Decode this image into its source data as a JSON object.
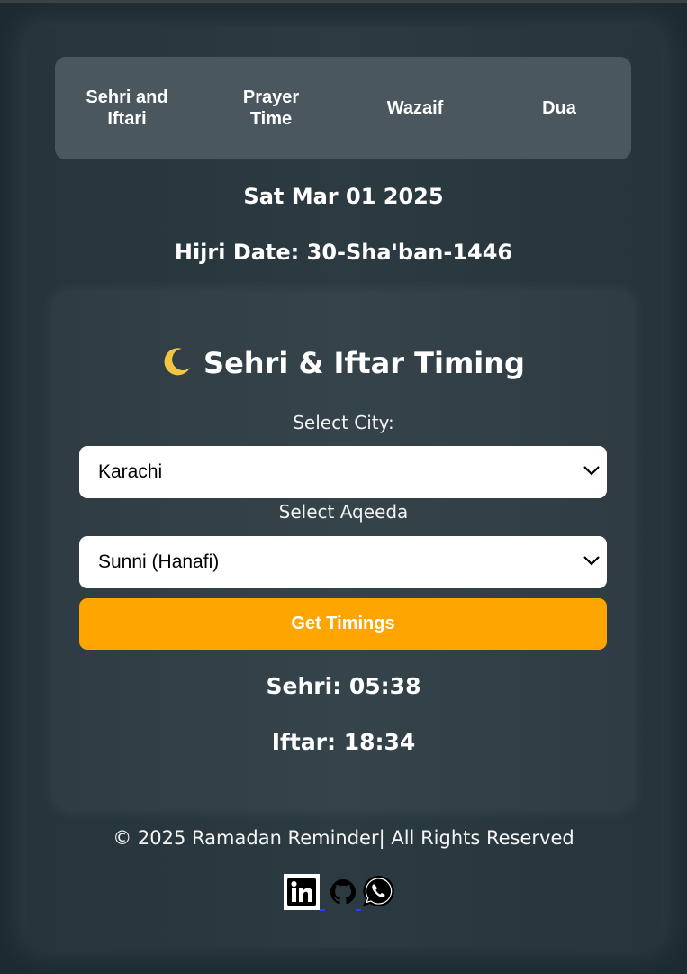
{
  "nav": {
    "items": [
      {
        "label": "Sehri and Iftari"
      },
      {
        "label": "Prayer Time"
      },
      {
        "label": "Wazaif"
      },
      {
        "label": "Dua"
      }
    ]
  },
  "header": {
    "date": "Sat Mar 01 2025",
    "hijri": "Hijri Date: 30-Sha'ban-1446"
  },
  "card": {
    "title": "Sehri & Iftar Timing",
    "icon": "crescent-moon-icon",
    "city_label": "Select City:",
    "city_value": "Karachi",
    "aqeeda_label": "Select Aqeeda",
    "aqeeda_value": "Sunni (Hanafi)",
    "button_label": "Get Timings",
    "sehri": "Sehri: 05:38",
    "iftar": "Iftar: 18:34"
  },
  "footer": {
    "text": "© 2025 Ramadan Reminder| All Rights Reserved",
    "socials": [
      "linkedin-icon",
      "github-icon",
      "whatsapp-icon"
    ]
  },
  "colors": {
    "background": "#1d2a31",
    "nav": "#4a575e",
    "button": "#ffa500",
    "moon": "#f4c542"
  }
}
